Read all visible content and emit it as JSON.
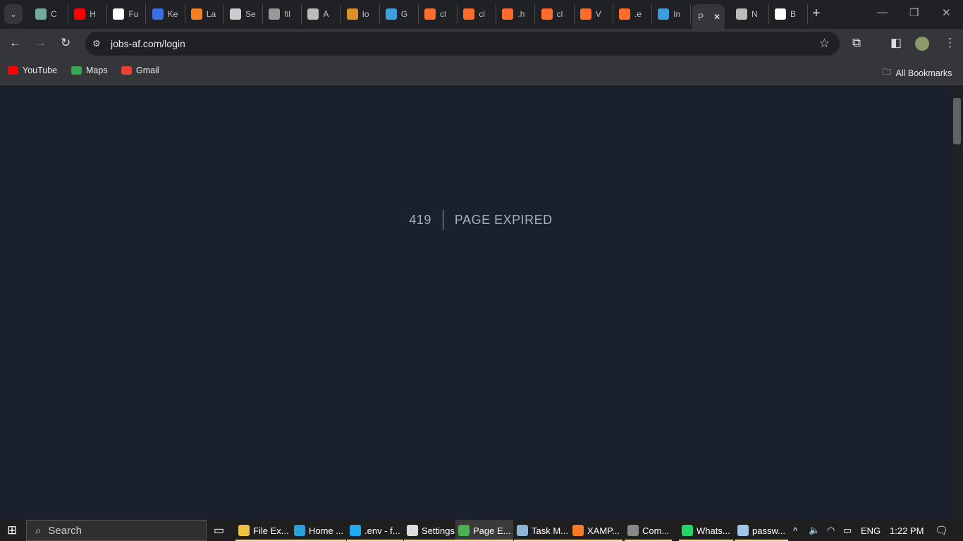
{
  "tabs": [
    {
      "label": "C",
      "color": "#74aa9c"
    },
    {
      "label": "H",
      "color": "#ff0000"
    },
    {
      "label": "Fu",
      "color": "#ffffff"
    },
    {
      "label": "Ke",
      "color": "#3a6ee8"
    },
    {
      "label": "La",
      "color": "#f48024"
    },
    {
      "label": "Se",
      "color": "#cccccc"
    },
    {
      "label": "fil",
      "color": "#999999"
    },
    {
      "label": "A",
      "color": "#bbbbbb"
    },
    {
      "label": "Io",
      "color": "#e0902a"
    },
    {
      "label": "G",
      "color": "#3aa0e0"
    },
    {
      "label": "cl",
      "color": "#ff6c2c"
    },
    {
      "label": "cl",
      "color": "#ff6c2c"
    },
    {
      "label": ".h",
      "color": "#ff6c2c"
    },
    {
      "label": "cl",
      "color": "#ff6c2c"
    },
    {
      "label": "V",
      "color": "#ff6c2c"
    },
    {
      "label": ".e",
      "color": "#ff6c2c"
    },
    {
      "label": "In",
      "color": "#3aa0e0"
    },
    {
      "label": "P",
      "color": "",
      "active": true
    },
    {
      "label": "N",
      "color": "#bbbbbb"
    },
    {
      "label": "B",
      "color": "#ffffff"
    }
  ],
  "address": "jobs-af.com/login",
  "bookmarks": [
    {
      "label": "YouTube",
      "color": "#ff0000"
    },
    {
      "label": "Maps",
      "color": "#34a853"
    },
    {
      "label": "Gmail",
      "color": "#ea4335"
    }
  ],
  "all_bookmarks": "All Bookmarks",
  "error": {
    "code": "419",
    "message": "PAGE EXPIRED"
  },
  "taskbar": {
    "search_placeholder": "Search",
    "apps": [
      {
        "label": "File Ex...",
        "color": "#f0c040"
      },
      {
        "label": "Home ...",
        "color": "#2a9fd8"
      },
      {
        "label": ".env - f...",
        "color": "#23a9f2"
      },
      {
        "label": "Settings",
        "color": "#dddddd"
      },
      {
        "label": "Page E...",
        "color": "#4caf50",
        "active": true
      },
      {
        "label": "Task M...",
        "color": "#8ab4d8"
      },
      {
        "label": "XAMP...",
        "color": "#fb7a24"
      },
      {
        "label": "Com...",
        "color": "#888888"
      },
      {
        "label": "Whats...",
        "color": "#25d366"
      },
      {
        "label": "passw...",
        "color": "#9fc5e8"
      }
    ],
    "language": "ENG",
    "time": "1:22 PM"
  }
}
